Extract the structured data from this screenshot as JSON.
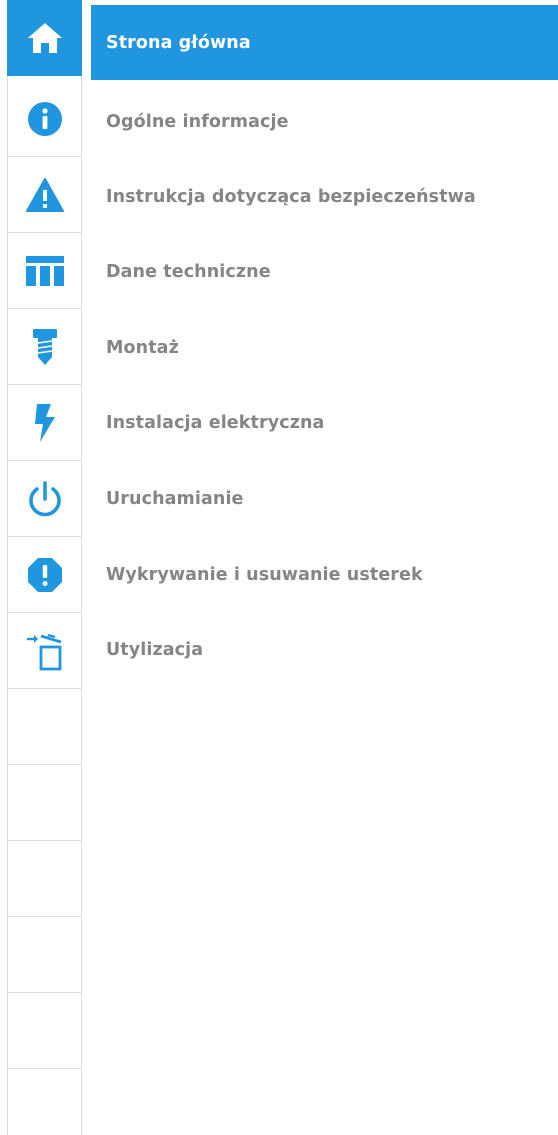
{
  "accent_color": "#2196e0",
  "text_color": "#858585",
  "nav": {
    "items": [
      {
        "label": "Strona główna",
        "icon": "home-icon",
        "active": true
      },
      {
        "label": "Ogólne informacje",
        "icon": "info-icon",
        "active": false
      },
      {
        "label": "Instrukcja dotycząca bezpieczeństwa",
        "icon": "warning-triangle-icon",
        "active": false
      },
      {
        "label": "Dane techniczne",
        "icon": "table-icon",
        "active": false
      },
      {
        "label": "Montaż",
        "icon": "screw-icon",
        "active": false
      },
      {
        "label": "Instalacja elektryczna",
        "icon": "lightning-icon",
        "active": false
      },
      {
        "label": "Uruchamianie",
        "icon": "power-icon",
        "active": false
      },
      {
        "label": "Wykrywanie i usuwanie usterek",
        "icon": "alert-octagon-icon",
        "active": false
      },
      {
        "label": "Utylizacja",
        "icon": "disposal-bin-icon",
        "active": false
      }
    ]
  }
}
